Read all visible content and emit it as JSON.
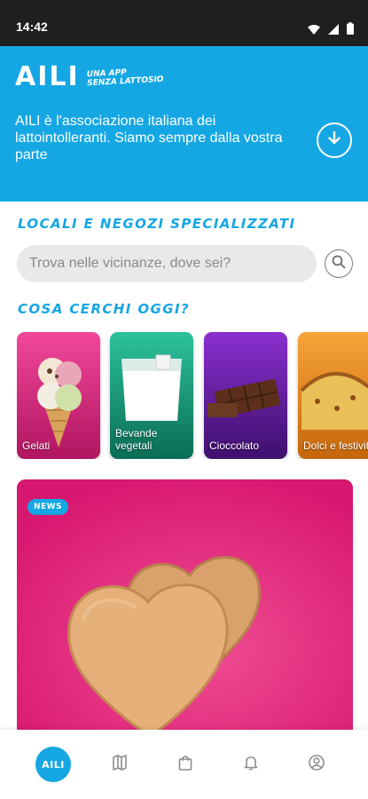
{
  "status_bar": {
    "time": "14:42",
    "icons": [
      "wifi-icon",
      "signal-icon",
      "battery-icon"
    ]
  },
  "header": {
    "logo": "AILI",
    "tagline_line1": "UNA APP",
    "tagline_line2": "SENZA LATTOSIO",
    "description": "AILI è l'associazione italiana dei lattointolleranti. Siamo sempre dalla vostra parte",
    "download_icon": "download-circle-icon",
    "background_color": "#14a7e3"
  },
  "shops": {
    "title": "LOCALI E NEGOZI SPECIALIZZATI",
    "search_placeholder": "Trova nelle vicinanze, dove sei?",
    "search_value": "",
    "search_icon": "search-icon"
  },
  "categories": {
    "title": "COSA CERCHI OGGI?",
    "items": [
      {
        "label": "Gelati",
        "color": "#e62a83"
      },
      {
        "label": "Bevande vegetali",
        "color": "#18a585"
      },
      {
        "label": "Cioccolato",
        "color": "#6a1fa6"
      },
      {
        "label": "Dolci e festività",
        "color": "#f08c1c"
      }
    ]
  },
  "news": {
    "badge": "NEWS",
    "background_color": "#e8207c"
  },
  "bottom_nav": {
    "home_label": "AILI",
    "items": [
      "home-icon",
      "map-icon",
      "shopping-bag-icon",
      "bell-icon",
      "profile-icon"
    ],
    "accent": "#14a7e3"
  }
}
